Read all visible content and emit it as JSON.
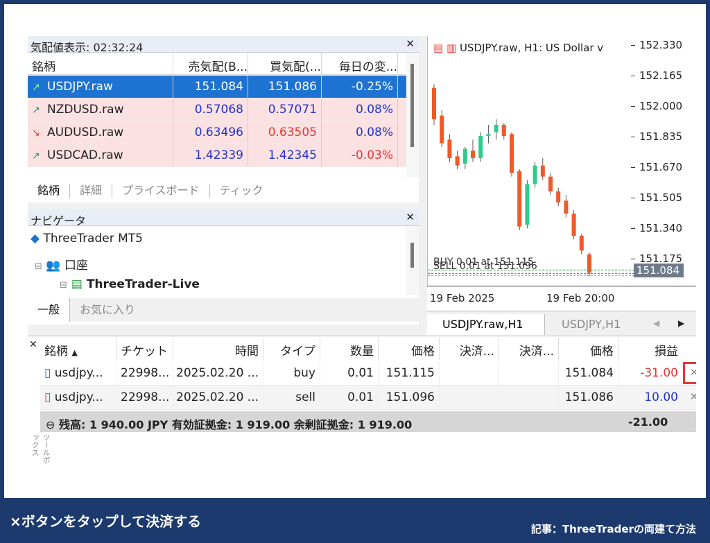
{
  "market_watch": {
    "title": "気配値表示: 02:32:24",
    "columns": [
      "銘柄",
      "売気配(B...",
      "買気配(...",
      "毎日の変..."
    ],
    "rows": [
      {
        "symbol": "USDJPY.raw",
        "bid": "151.084",
        "ask": "151.086",
        "change": "-0.25%",
        "dir": "up",
        "selected": true
      },
      {
        "symbol": "NZDUSD.raw",
        "bid": "0.57068",
        "ask": "0.57071",
        "change": "0.08%",
        "dir": "up",
        "selected": false
      },
      {
        "symbol": "AUDUSD.raw",
        "bid": "0.63496",
        "ask": "0.63505",
        "change": "0.08%",
        "dir": "down",
        "selected": false
      },
      {
        "symbol": "USDCAD.raw",
        "bid": "1.42339",
        "ask": "1.42345",
        "change": "-0.03%",
        "dir": "up",
        "selected": false
      }
    ],
    "tabs": [
      "銘柄",
      "詳細",
      "プライスボード",
      "ティック"
    ]
  },
  "navigator": {
    "title": "ナビゲータ",
    "root": "ThreeTrader MT5",
    "accounts": "口座",
    "server": "ThreeTrader-Live",
    "tabs": [
      "一般",
      "お気に入り"
    ]
  },
  "chart": {
    "header": "USDJPY.raw, H1:  US Dollar v",
    "buy_line": "BUY 0.01 at 151.115",
    "sell_line": "SELL 0.01 at 151.096",
    "price_labels": [
      "152.330",
      "152.165",
      "152.000",
      "151.835",
      "151.670",
      "151.505",
      "151.340",
      "151.175"
    ],
    "current_price": "151.084",
    "x_labels": [
      "19 Feb 2025",
      "19 Feb 20:00"
    ],
    "tabs": [
      "USDJPY.raw,H1",
      "USDJPY,H1"
    ]
  },
  "chart_data": {
    "type": "candlestick",
    "y_range": [
      151.03,
      152.38
    ],
    "candles": [
      [
        152.1,
        152.12,
        151.9,
        151.93
      ],
      [
        151.95,
        151.98,
        151.78,
        151.8
      ],
      [
        151.82,
        151.85,
        151.7,
        151.72
      ],
      [
        151.73,
        151.76,
        151.66,
        151.68
      ],
      [
        151.69,
        151.78,
        151.66,
        151.77
      ],
      [
        151.76,
        151.82,
        151.7,
        151.72
      ],
      [
        151.72,
        151.86,
        151.7,
        151.84
      ],
      [
        151.84,
        151.9,
        151.8,
        151.85
      ],
      [
        151.86,
        151.93,
        151.82,
        151.9
      ],
      [
        151.9,
        151.91,
        151.82,
        151.84
      ],
      [
        151.85,
        151.86,
        151.62,
        151.64
      ],
      [
        151.65,
        151.66,
        151.33,
        151.35
      ],
      [
        151.36,
        151.6,
        151.34,
        151.58
      ],
      [
        151.58,
        151.7,
        151.56,
        151.68
      ],
      [
        151.68,
        151.72,
        151.6,
        151.62
      ],
      [
        151.62,
        151.64,
        151.52,
        151.54
      ],
      [
        151.54,
        151.56,
        151.46,
        151.48
      ],
      [
        151.49,
        151.52,
        151.4,
        151.42
      ],
      [
        151.42,
        151.44,
        151.28,
        151.3
      ],
      [
        151.3,
        151.31,
        151.2,
        151.22
      ],
      [
        151.2,
        151.21,
        151.08,
        151.1
      ]
    ],
    "buy_price": 151.115,
    "sell_price": 151.096,
    "current": 151.084
  },
  "toolbox": {
    "columns": [
      "銘柄",
      "チケット",
      "時間",
      "タイプ",
      "数量",
      "価格",
      "決済...",
      "決済...",
      "価格",
      "損益"
    ],
    "rows": [
      {
        "symbol": "usdjpy...",
        "ticket": "22998...",
        "time": "2025.02.20 ...",
        "type": "buy",
        "volume": "0.01",
        "price": "151.115",
        "sl": "",
        "tp": "",
        "cur": "151.084",
        "profit": "-31.00"
      },
      {
        "symbol": "usdjpy...",
        "ticket": "22998...",
        "time": "2025.02.20 ...",
        "type": "sell",
        "volume": "0.01",
        "price": "151.096",
        "sl": "",
        "tp": "",
        "cur": "151.086",
        "profit": "10.00"
      }
    ],
    "summary": "残高: 1 940.00 JPY  有効証拠金: 1 919.00  余剰証拠金: 1 919.00",
    "summary_total": "-21.00",
    "side_label": "ツールボックス"
  },
  "caption": "×ボタンをタップして決済する",
  "credit": "記事：ThreeTraderの両建て方法",
  "colors": {
    "bull": "#2ecc8a",
    "bear": "#f05a28",
    "highlight": "#e53935",
    "selected": "#1e73d2"
  }
}
